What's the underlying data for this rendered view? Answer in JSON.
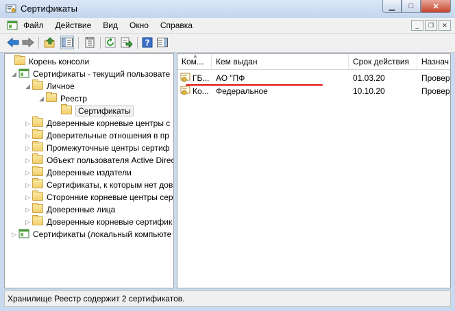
{
  "window": {
    "title": "Сертификаты"
  },
  "menu": {
    "items": [
      "Файл",
      "Действие",
      "Вид",
      "Окно",
      "Справка"
    ]
  },
  "toolbar": {
    "icons": [
      "back-icon",
      "forward-icon",
      "up-icon",
      "show-tree-icon",
      "properties-icon",
      "refresh-icon",
      "export-icon",
      "help-icon",
      "action-pane-icon"
    ]
  },
  "tree": {
    "root": "Корень консоли",
    "items": [
      "Сертификаты - текущий пользовате",
      "Личное",
      "Реестр",
      "Сертификаты",
      "Доверенные корневые центры с",
      "Доверительные отношения в пр",
      "Промежуточные центры сертиф",
      "Объект пользователя Active Direc",
      "Доверенные издатели",
      "Сертификаты, к которым нет дов",
      "Сторонние корневые центры сер",
      "Доверенные лица",
      "Доверенные корневые сертифик",
      "Сертификаты (локальный компьюте"
    ]
  },
  "list": {
    "columns": [
      "Ком...",
      "Кем выдан",
      "Срок действия",
      "Назнач"
    ],
    "rows": [
      [
        "ГБ...",
        "АО \"ПФ",
        "01.03.20",
        "Провер"
      ],
      [
        "Ко...",
        "Федеральное",
        "10.10.20",
        "Провер"
      ]
    ]
  },
  "status": {
    "text": "Хранилище Реестр содержит 2 сертификатов."
  },
  "colors": {
    "annotation_line": "#e01010",
    "title_gradient": "#c3d5ee"
  }
}
